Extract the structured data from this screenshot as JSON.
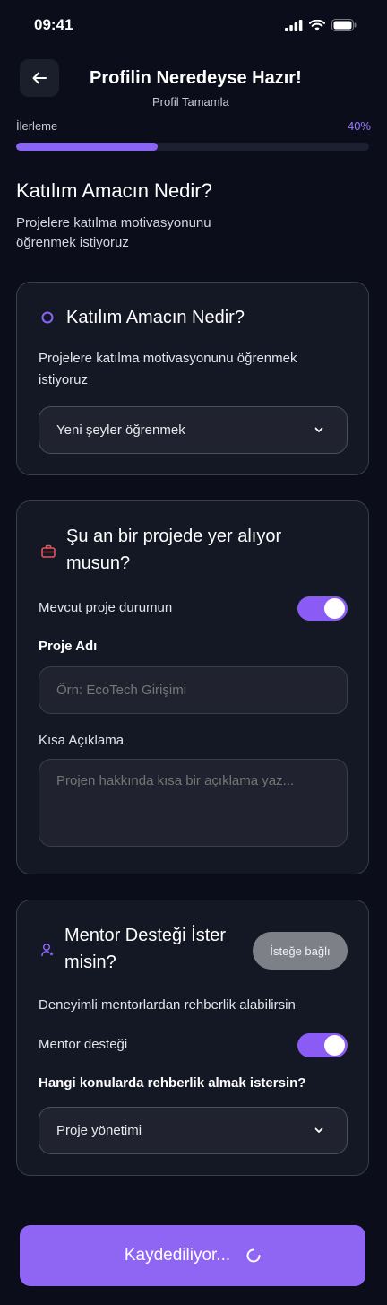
{
  "status_bar": {
    "time": "09:41"
  },
  "header": {
    "title": "Profilin Neredeyse Hazır!",
    "subtitle": "Profil Tamamla"
  },
  "progress": {
    "label": "İlerleme",
    "value_text": "40%",
    "value": 0.4
  },
  "intro": {
    "title": "Katılım Amacın Nedir?",
    "description": "Projelere katılma motivasyonunu öğrenmek istiyoruz"
  },
  "purpose_card": {
    "title": "Katılım Amacın Nedir?",
    "description": "Projelere katılma motivasyonunu öğrenmek istiyoruz",
    "selected": "Yeni şeyler öğrenmek"
  },
  "project_card": {
    "title": "Şu an bir projede yer alıyor musun?",
    "toggle_label": "Mevcut proje durumun",
    "toggle_on": true,
    "name_label": "Proje Adı",
    "name_placeholder": "Örn: EcoTech Girişimi",
    "desc_label": "Kısa Açıklama",
    "desc_placeholder": "Projen hakkında kısa bir açıklama yaz..."
  },
  "mentor_card": {
    "title": "Mentor Desteği İster misin?",
    "badge": "İsteğe bağlı",
    "description": "Deneyimli mentorlardan rehberlik alabilirsin",
    "toggle_label": "Mentor desteği",
    "toggle_on": true,
    "topics_label": "Hangi konularda rehberlik almak istersin?",
    "selected": "Proje yönetimi"
  },
  "save_button": {
    "label": "Kaydediliyor..."
  },
  "colors": {
    "accent": "#8a5cf5",
    "background": "#0b0d1a",
    "card": "#141724",
    "danger_icon": "#e0575b"
  }
}
